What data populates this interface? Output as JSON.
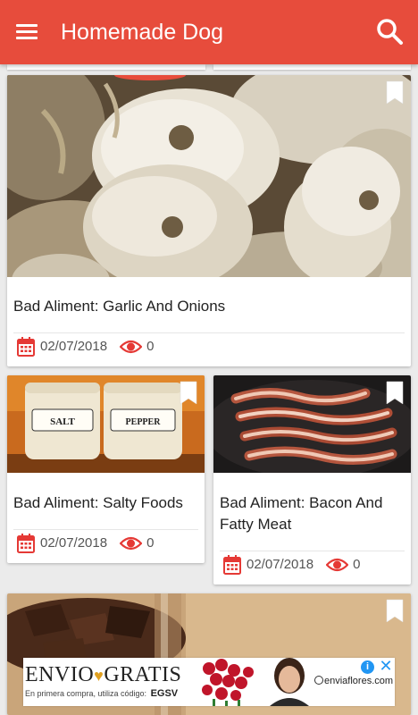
{
  "app": {
    "title": "Homemade Dog"
  },
  "icons": {
    "menu": "menu-icon",
    "search": "search-icon",
    "bookmark": "bookmark-icon",
    "calendar": "calendar-icon",
    "views": "eye-icon"
  },
  "colors": {
    "primary": "#e74c3c",
    "accent_red": "#e53935",
    "background": "#ebebeb"
  },
  "cards": [
    {
      "title": "Bad Aliment: Garlic And Onions",
      "date": "02/07/2018",
      "views": "0"
    },
    {
      "title": "Bad Aliment: Salty Foods",
      "date": "02/07/2018",
      "views": "0"
    },
    {
      "title": "Bad Aliment: Bacon And Fatty Meat",
      "date": "02/07/2018",
      "views": "0"
    }
  ],
  "images": {
    "salt_jar_label": "SALT",
    "pepper_jar_label": "PEPPER"
  },
  "ad": {
    "headline_left": "ENVIO",
    "headline_right": "GRATIS",
    "subtext": "En primera compra, utiliza código:",
    "code": "EGSV",
    "brand": "enviaflores.com",
    "info_label": "i",
    "close_label": "✕"
  }
}
